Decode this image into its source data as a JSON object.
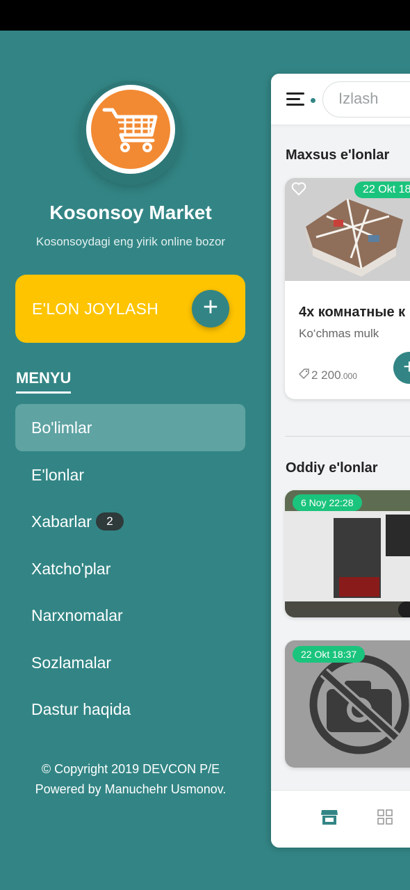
{
  "drawer": {
    "app_name": "Kosonsoy Market",
    "tagline": "Kosonsoydagi eng yirik online bozor",
    "post_button_label": "E'LON JOYLASH",
    "post_button_icon": "plus-icon",
    "menu_heading": "MENYU",
    "menu_items": [
      {
        "label": "Bo'limlar",
        "active": true
      },
      {
        "label": "E'lonlar"
      },
      {
        "label": "Xabarlar",
        "badge": "2"
      },
      {
        "label": "Xatcho'plar"
      },
      {
        "label": "Narxnomalar"
      },
      {
        "label": "Sozlamalar"
      },
      {
        "label": "Dastur haqida"
      }
    ],
    "copyright_line1": "© Copyright 2019 DEVCON P/E",
    "copyright_line2": "Powered by Manuchehr Usmonov."
  },
  "main": {
    "search_placeholder": "Izlash",
    "special_section_title": "Maxsus e'lonlar",
    "special_card": {
      "date": "22 Okt 18",
      "title": "4x комнатные к",
      "category": "Ko‘chmas mulk",
      "price_main": "2 200",
      "price_small": ".000"
    },
    "regular_section_title": "Oddiy e'lonlar",
    "regular_cards": [
      {
        "date": "6 Noy 22:28"
      },
      {
        "date": "22 Okt 18:37"
      }
    ]
  },
  "colors": {
    "teal": "#338585",
    "yellow": "#fec400",
    "orange": "#f28a33",
    "green_badge": "#1bc47d"
  }
}
